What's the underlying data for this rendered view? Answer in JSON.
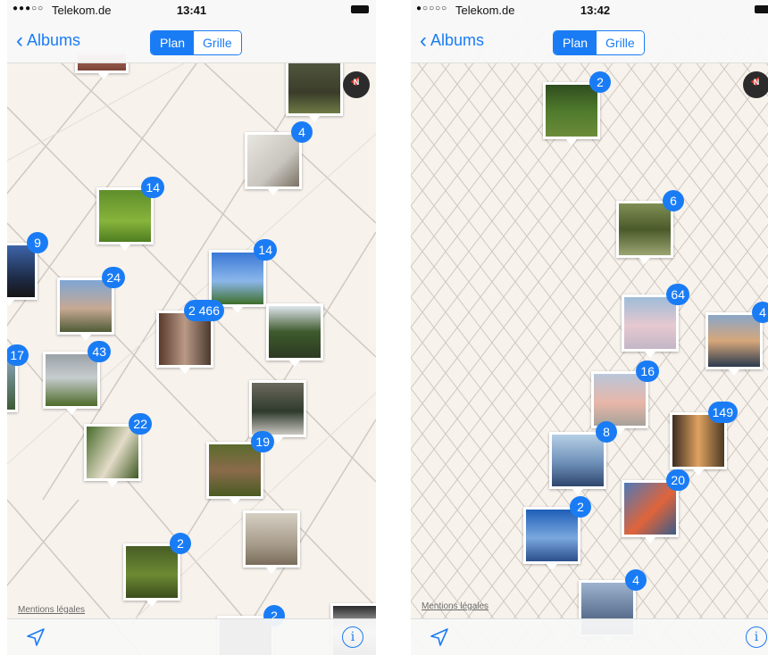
{
  "left": {
    "status": {
      "signal": "●●●○○",
      "carrier": "Telekom.de",
      "time": "13:41"
    },
    "nav": {
      "back_label": "Albums",
      "seg_plan": "Plan",
      "seg_grille": "Grille"
    },
    "legal": "Mentions légales",
    "pins": [
      {
        "count": "4"
      },
      {
        "count": "14"
      },
      {
        "count": "9"
      },
      {
        "count": "14"
      },
      {
        "count": "24"
      },
      {
        "count": "2 466"
      },
      {
        "count": "17"
      },
      {
        "count": "43"
      },
      {
        "count": "22"
      },
      {
        "count": "19"
      },
      {
        "count": "2"
      },
      {
        "count": "2"
      }
    ]
  },
  "right": {
    "status": {
      "signal": "●○○○○",
      "carrier": "Telekom.de",
      "time": "13:42"
    },
    "nav": {
      "back_label": "Albums",
      "seg_plan": "Plan",
      "seg_grille": "Grille"
    },
    "legal": "Mentions légales",
    "pins": [
      {
        "count": "2"
      },
      {
        "count": "6"
      },
      {
        "count": "64"
      },
      {
        "count": "4"
      },
      {
        "count": "16"
      },
      {
        "count": "149"
      },
      {
        "count": "8"
      },
      {
        "count": "20"
      },
      {
        "count": "2"
      },
      {
        "count": "4"
      }
    ]
  },
  "icons": {
    "back": "chevron-left-icon",
    "compass": "compass-icon",
    "location": "location-arrow-icon",
    "info": "info-icon"
  },
  "colors": {
    "accent": "#1a7cf5",
    "map_bg": "#f7f2ec"
  }
}
